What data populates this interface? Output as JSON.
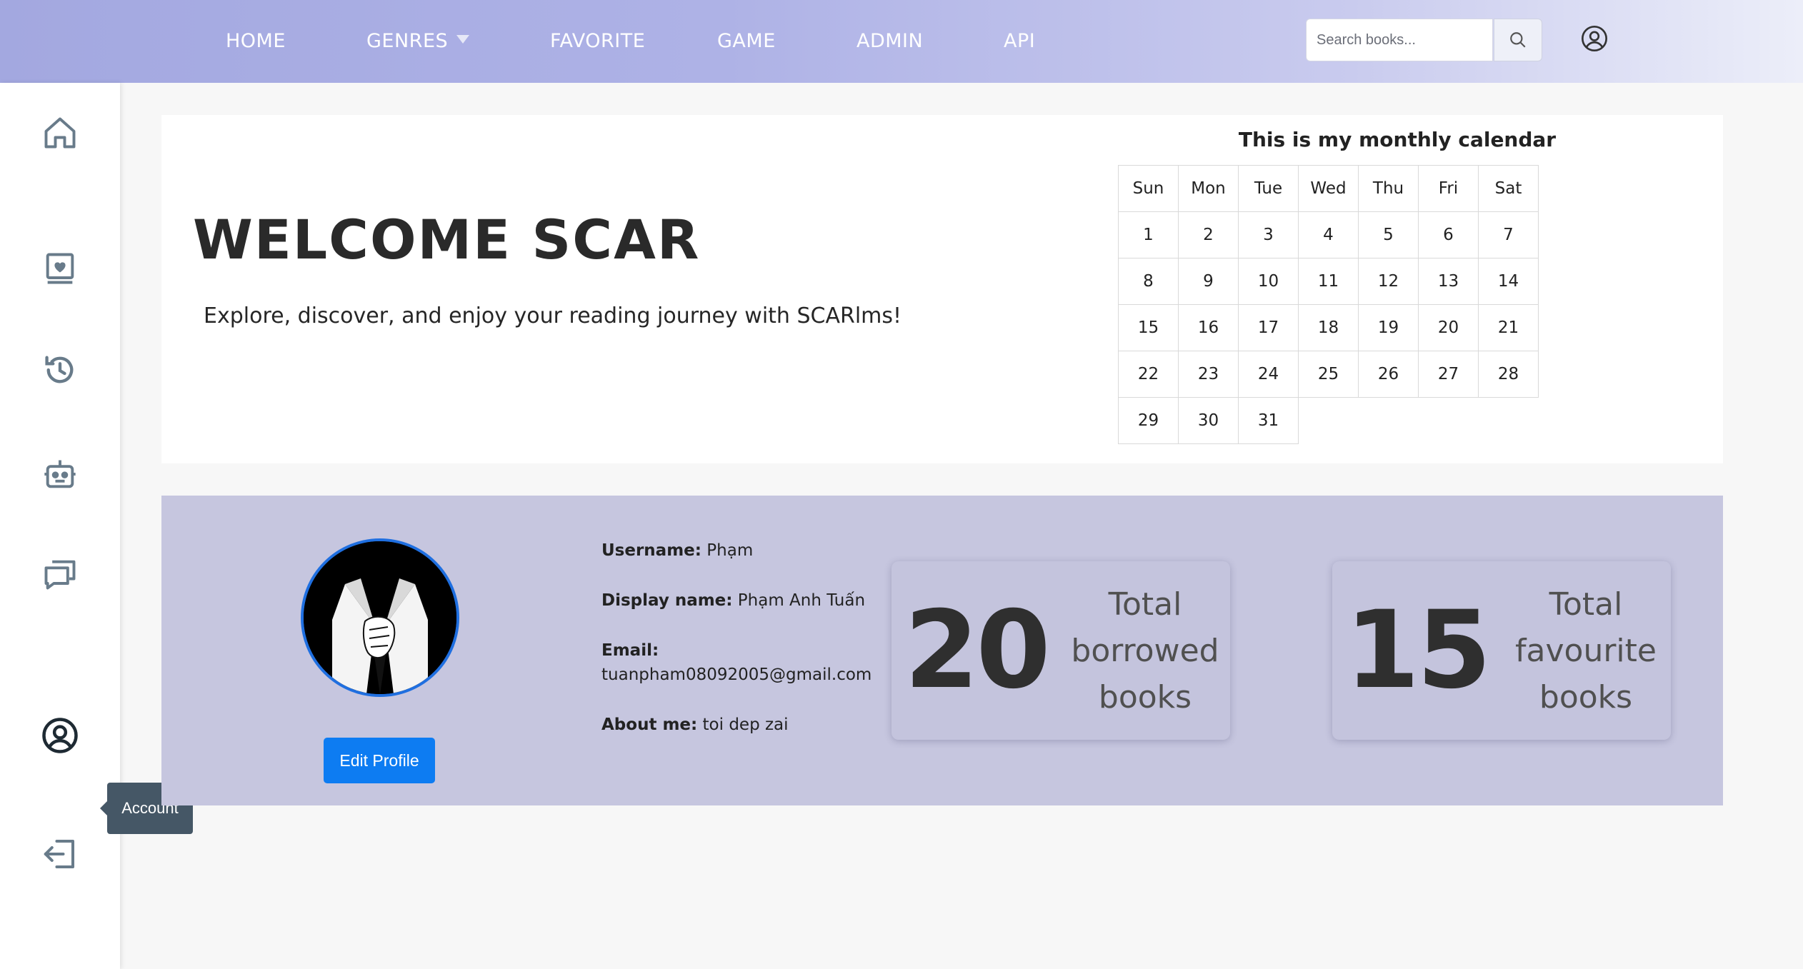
{
  "nav": {
    "items": [
      {
        "label": "HOME"
      },
      {
        "label": "GENRES"
      },
      {
        "label": "FAVORITE"
      },
      {
        "label": "GAME"
      },
      {
        "label": "ADMIN"
      },
      {
        "label": "API"
      }
    ],
    "search_placeholder": "Search books..."
  },
  "sidebar": {
    "icons": [
      "home-icon",
      "favorite-books-icon",
      "history-icon",
      "robot-icon",
      "chat-icon",
      "account-icon",
      "logout-icon"
    ],
    "tooltip": "Account"
  },
  "welcome": {
    "title": "WELCOME SCAR",
    "subtitle": "Explore, discover, and enjoy your reading journey with SCARlms!"
  },
  "calendar": {
    "title": "This is my monthly calendar",
    "days": [
      "Sun",
      "Mon",
      "Tue",
      "Wed",
      "Thu",
      "Fri",
      "Sat"
    ],
    "weeks": [
      [
        "1",
        "2",
        "3",
        "4",
        "5",
        "6",
        "7"
      ],
      [
        "8",
        "9",
        "10",
        "11",
        "12",
        "13",
        "14"
      ],
      [
        "15",
        "16",
        "17",
        "18",
        "19",
        "20",
        "21"
      ],
      [
        "22",
        "23",
        "24",
        "25",
        "26",
        "27",
        "28"
      ],
      [
        "29",
        "30",
        "31",
        "",
        "",
        "",
        ""
      ]
    ]
  },
  "profile": {
    "username_label": "Username:",
    "username": "Phạm",
    "display_label": "Display name:",
    "display_name": "Phạm Anh Tuấn",
    "email_label": "Email:",
    "email": "tuanpham08092005@gmail.com",
    "about_label": "About me:",
    "about": "toi dep zai",
    "edit_button": "Edit Profile"
  },
  "stats": {
    "borrowed": {
      "value": "20",
      "label_lines": [
        "Total",
        "borrowed",
        "books"
      ]
    },
    "favourite": {
      "value": "15",
      "label_lines": [
        "Total",
        "favourite",
        "books"
      ]
    }
  },
  "colors": {
    "accent": "#0d7cf2",
    "profile_bg": "#c6c6df",
    "tooltip_bg": "#455766"
  }
}
